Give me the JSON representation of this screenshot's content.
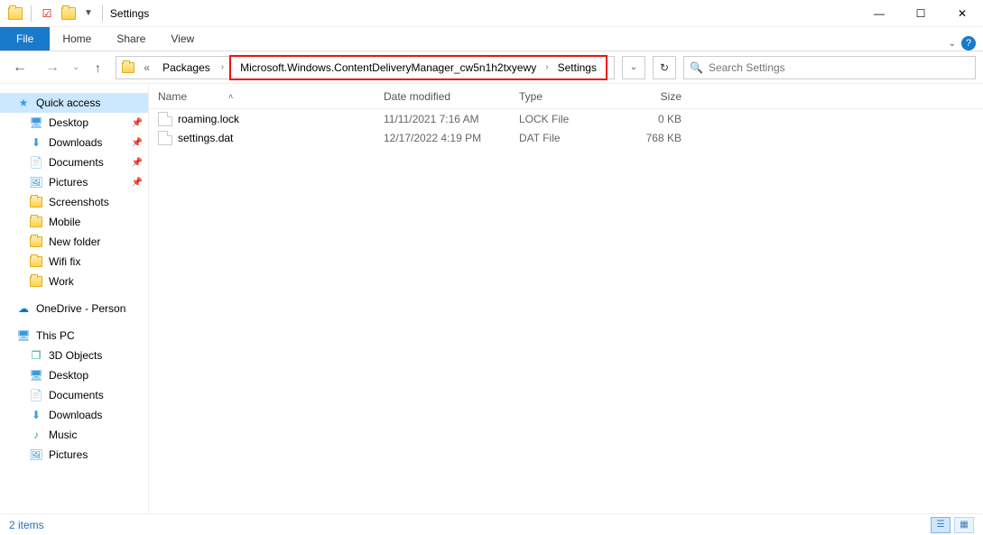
{
  "window": {
    "title": "Settings"
  },
  "ribbon": {
    "file": "File",
    "home": "Home",
    "share": "Share",
    "view": "View"
  },
  "address": {
    "root_label": "Packages",
    "seg1": "Microsoft.Windows.ContentDeliveryManager_cw5n1h2txyewy",
    "seg2": "Settings",
    "prefix_marker": "«"
  },
  "search": {
    "placeholder": "Search Settings"
  },
  "sidebar": {
    "quick_access": "Quick access",
    "desktop": "Desktop",
    "downloads": "Downloads",
    "documents": "Documents",
    "pictures": "Pictures",
    "screenshots": "Screenshots",
    "mobile": "Mobile",
    "new_folder": "New folder",
    "wifi_fix": "Wifi fix",
    "work": "Work",
    "onedrive": "OneDrive - Person",
    "this_pc": "This PC",
    "obj3d": "3D Objects",
    "desktop2": "Desktop",
    "documents2": "Documents",
    "downloads2": "Downloads",
    "music": "Music",
    "pictures2": "Pictures"
  },
  "columns": {
    "name": "Name",
    "date": "Date modified",
    "type": "Type",
    "size": "Size"
  },
  "files": [
    {
      "name": "roaming.lock",
      "date": "11/11/2021 7:16 AM",
      "type": "LOCK File",
      "size": "0 KB"
    },
    {
      "name": "settings.dat",
      "date": "12/17/2022 4:19 PM",
      "type": "DAT File",
      "size": "768 KB"
    }
  ],
  "status": {
    "items": "2 items"
  }
}
